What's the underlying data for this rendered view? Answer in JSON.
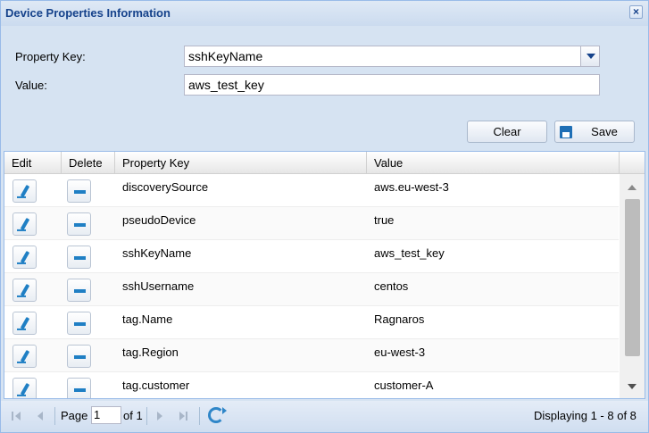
{
  "window": {
    "title": "Device Properties Information",
    "close_glyph": "×"
  },
  "form": {
    "property_key_label": "Property Key:",
    "property_key_value": "sshKeyName",
    "value_label": "Value:",
    "value_value": "aws_test_key",
    "clear_label": "Clear",
    "save_label": "Save"
  },
  "grid": {
    "columns": [
      "Edit",
      "Delete",
      "Property Key",
      "Value"
    ],
    "rows": [
      {
        "key": "discoverySource",
        "value": "aws.eu-west-3"
      },
      {
        "key": "pseudoDevice",
        "value": "true"
      },
      {
        "key": "sshKeyName",
        "value": "aws_test_key"
      },
      {
        "key": "sshUsername",
        "value": "centos"
      },
      {
        "key": "tag.Name",
        "value": "Ragnaros"
      },
      {
        "key": "tag.Region",
        "value": "eu-west-3"
      },
      {
        "key": "tag.customer",
        "value": "customer-A"
      }
    ]
  },
  "pager": {
    "page_label": "Page",
    "page_value": "1",
    "of_label": "of 1",
    "display_text": "Displaying 1 - 8 of 8"
  },
  "icons": {
    "edit": "pencil-icon",
    "delete": "minus-icon",
    "save": "floppy-icon",
    "refresh": "refresh-icon"
  },
  "colors": {
    "title_text": "#15428b",
    "panel_bg": "#d6e3f2",
    "accent": "#1f7fc4"
  }
}
